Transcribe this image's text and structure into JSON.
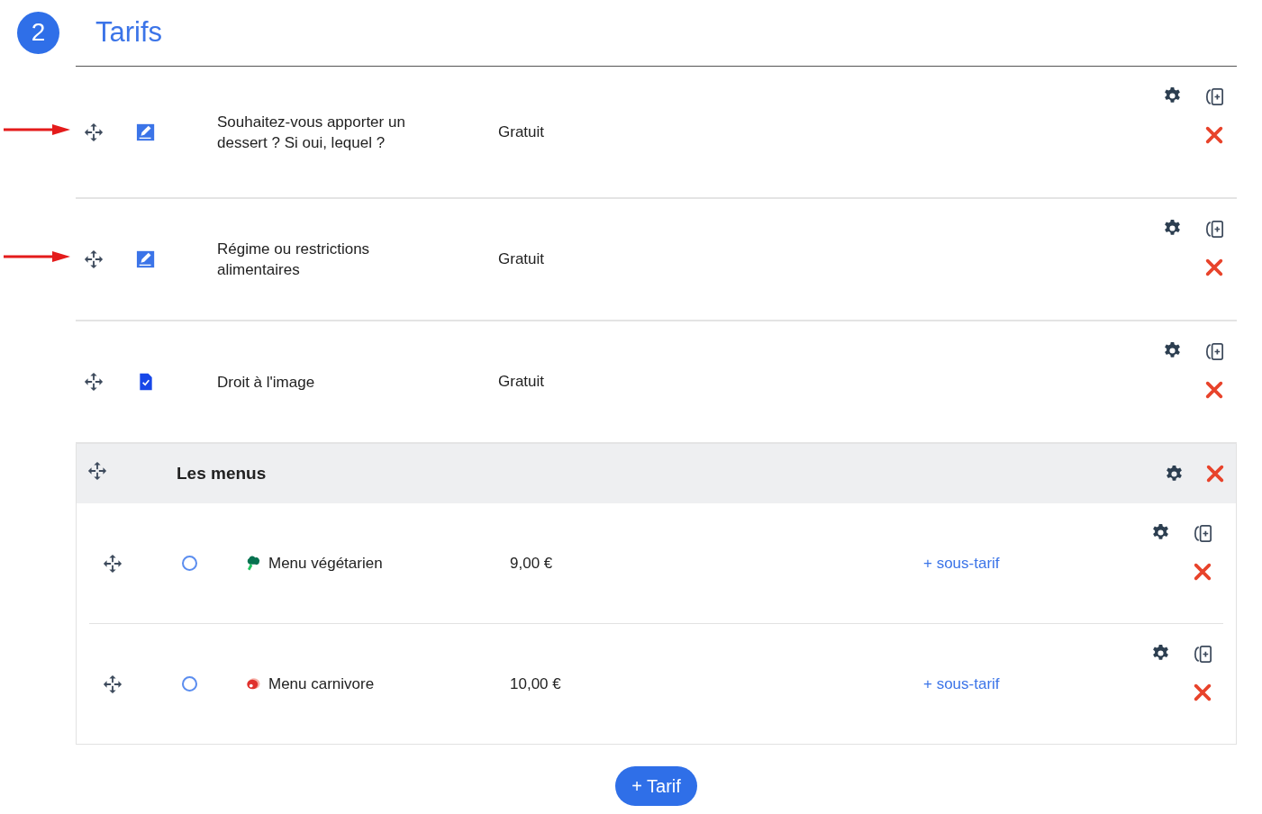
{
  "header": {
    "step": "2",
    "title": "Tarifs"
  },
  "items": [
    {
      "kind": "text-field",
      "label": "Souhaitez-vous apporter un dessert ? Si oui, lequel ?",
      "price": "Gratuit",
      "arrow": true
    },
    {
      "kind": "text-field",
      "label": "Régime ou restrictions alimentaires",
      "price": "Gratuit",
      "arrow": true
    },
    {
      "kind": "checkbox-field",
      "label": "Droit à l'image",
      "price": "Gratuit",
      "arrow": false
    },
    {
      "kind": "group",
      "title": "Les menus",
      "items": [
        {
          "kind": "vegetarian",
          "label": "Menu végétarien",
          "price": "9,00 €",
          "link": "+ sous-tarif",
          "selected": false
        },
        {
          "kind": "carnivore",
          "label": "Menu carnivore",
          "price": "10,00 €",
          "link": "+ sous-tarif",
          "selected": false
        }
      ]
    }
  ],
  "add_button": "+ Tarif"
}
